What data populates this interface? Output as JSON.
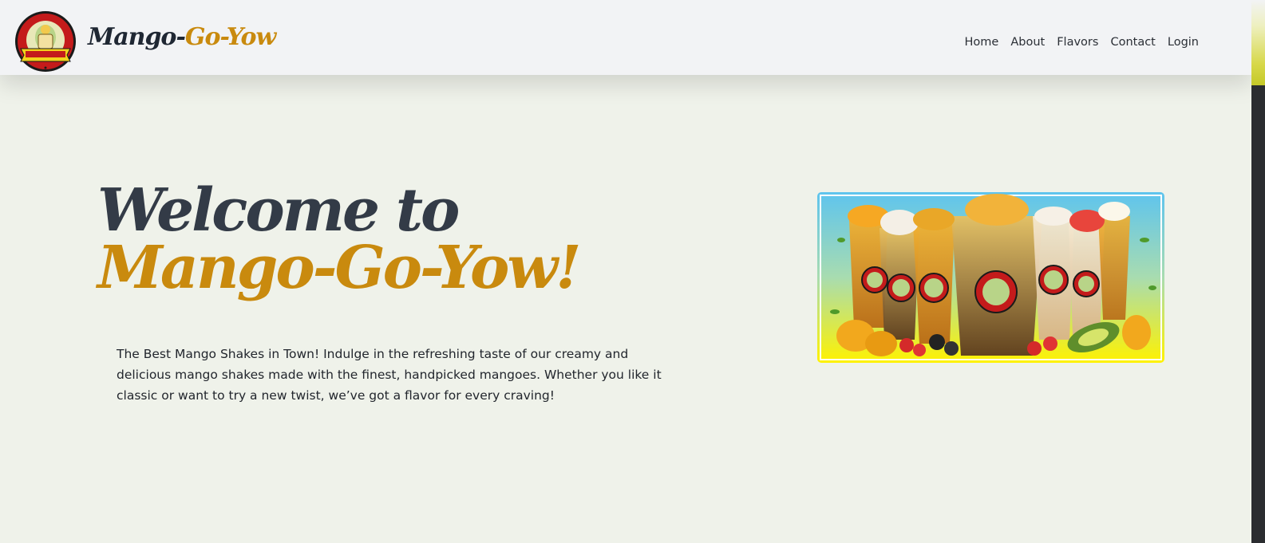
{
  "header": {
    "logo_icon": "mango-go-yow-badge-logo",
    "brand_part1": "Mango-",
    "brand_part2": "Go-Yow",
    "nav": [
      "Home",
      "About",
      "Flavors",
      "Contact",
      "Login"
    ]
  },
  "hero": {
    "title_part1": "Welcome to ",
    "title_part2": "Mango-Go-Yow!",
    "description": "The Best Mango Shakes in Town! Indulge in the refreshing taste of our creamy and delicious mango shakes made with the finest, handpicked mangoes. Whether you like it classic or want to try a new twist, we’ve got a flavor for every craving!",
    "image": "mango-shakes-product-photo"
  },
  "colors": {
    "background": "#eff2ea",
    "header_bg": "#f2f3f5",
    "dark_text": "#333b47",
    "gold_accent": "#c98a0e"
  }
}
